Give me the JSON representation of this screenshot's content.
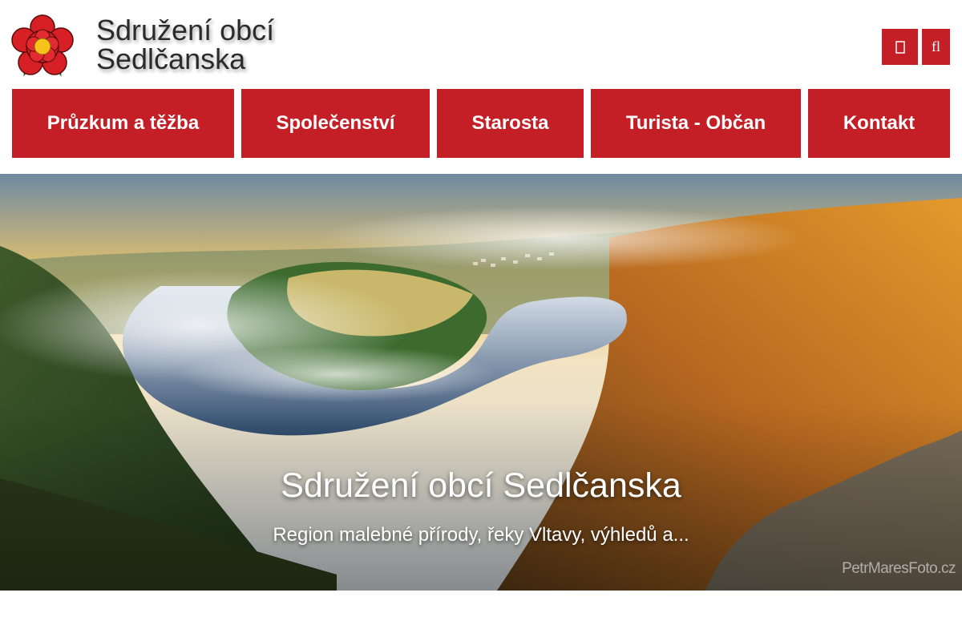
{
  "header": {
    "title_line1": "Sdružení obcí",
    "title_line2": "Sedlčanska",
    "logo_icon": "red-rose-emblem-icon",
    "tools": [
      {
        "icon": "unknown-glyph-icon",
        "label": ""
      },
      {
        "icon": "search-icon",
        "label": "fl"
      }
    ]
  },
  "nav": {
    "items": [
      {
        "label": "Průzkum a těžba"
      },
      {
        "label": "Společenství"
      },
      {
        "label": "Starosta"
      },
      {
        "label": "Turista - Občan"
      },
      {
        "label": "Kontakt"
      }
    ]
  },
  "hero": {
    "title": "Sdružení obcí Sedlčanska",
    "subtitle": "Region malebné přírody, řeky Vltavy, výhledů a...",
    "watermark": "PetrMaresFoto.cz"
  },
  "colors": {
    "accent": "#c41f26",
    "title_text": "#2b2b2b",
    "background": "#ffffff"
  }
}
